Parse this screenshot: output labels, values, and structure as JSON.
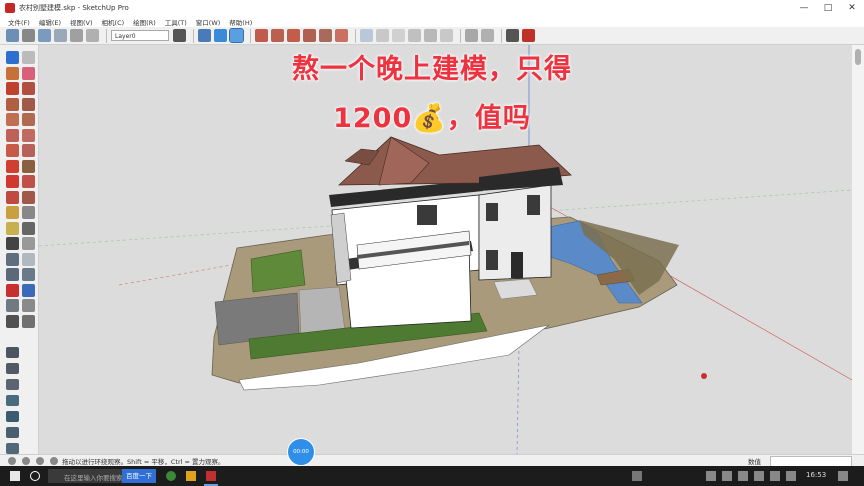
{
  "window": {
    "title": "农村别墅建模.skp - SketchUp Pro",
    "controls": [
      "—",
      "□",
      "✕"
    ]
  },
  "menu": [
    "文件(F)",
    "编辑(E)",
    "视图(V)",
    "相机(C)",
    "绘图(R)",
    "工具(T)",
    "窗口(W)",
    "帮助(H)"
  ],
  "toolbar": {
    "layer_value": "Layer0"
  },
  "overlay": {
    "line1": "熬一个晚上建模，只得",
    "line2": "1200💰，值吗"
  },
  "status": {
    "hint": "拖动以进行环绕观察。Shift = 平移，Ctrl = 置力观察。",
    "measure_label": "数值"
  },
  "taskbar": {
    "search_placeholder": "在这里输入你要搜索的内容",
    "search_button": "百度一下",
    "time": "16:53"
  },
  "bubble": "00:00",
  "colors": {
    "overlay_red": "#ee3340",
    "sky": "#dcdcdc",
    "roof": "#8b5a4d",
    "wall": "#ffffff",
    "grass": "#5f8a3a"
  }
}
